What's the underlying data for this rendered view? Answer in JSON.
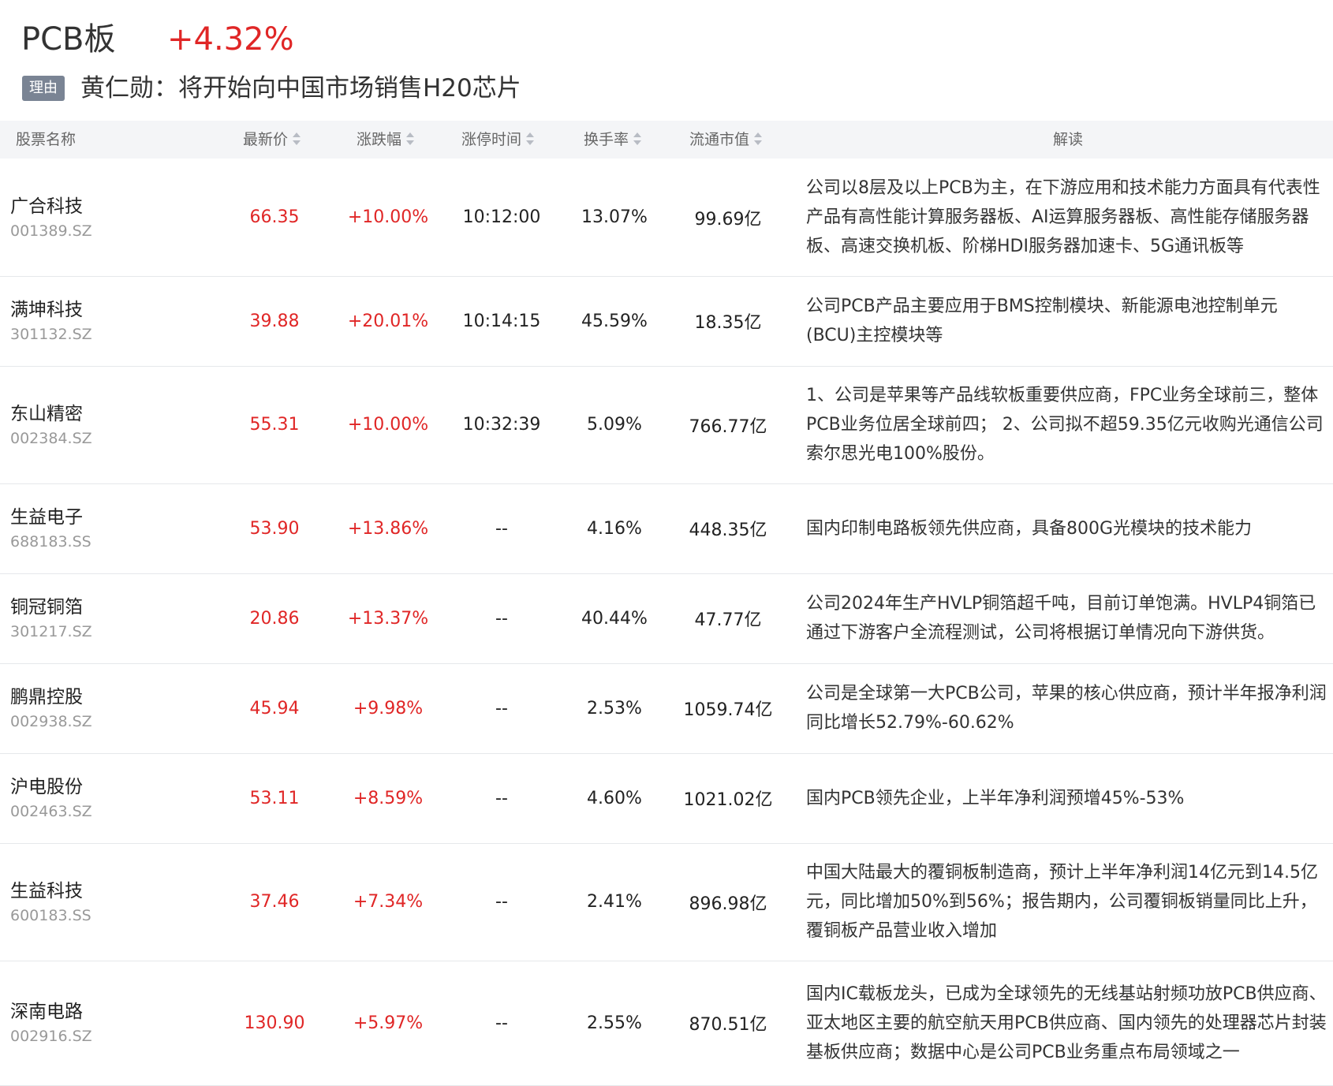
{
  "header": {
    "sector_name": "PCB板",
    "sector_change": "+4.32%",
    "reason_badge": "理由",
    "reason_text": "黄仁勋：将开始向中国市场销售H20芯片"
  },
  "table": {
    "columns": {
      "name": "股票名称",
      "price": "最新价",
      "change": "涨跌幅",
      "limit_time": "涨停时间",
      "turnover": "换手率",
      "market_cap": "流通市值",
      "desc": "解读"
    },
    "rows": [
      {
        "name": "广合科技",
        "code": "001389.SZ",
        "price": "66.35",
        "change": "+10.00%",
        "limit_time": "10:12:00",
        "turnover": "13.07%",
        "market_cap": "99.69亿",
        "desc": "公司以8层及以上PCB为主，在下游应用和技术能力方面具有代表性产品有高性能计算服务器板、AI运算服务器板、高性能存储服务器板、高速交换机板、阶梯HDI服务器加速卡、5G通讯板等"
      },
      {
        "name": "满坤科技",
        "code": "301132.SZ",
        "price": "39.88",
        "change": "+20.01%",
        "limit_time": "10:14:15",
        "turnover": "45.59%",
        "market_cap": "18.35亿",
        "desc": "公司PCB产品主要应用于BMS控制模块、新能源电池控制单元(BCU)主控模块等"
      },
      {
        "name": "东山精密",
        "code": "002384.SZ",
        "price": "55.31",
        "change": "+10.00%",
        "limit_time": "10:32:39",
        "turnover": "5.09%",
        "market_cap": "766.77亿",
        "desc": "1、公司是苹果等产品线软板重要供应商，FPC业务全球前三，整体PCB业务位居全球前四； 2、公司拟不超59.35亿元收购光通信公司索尔思光电100%股份。"
      },
      {
        "name": "生益电子",
        "code": "688183.SS",
        "price": "53.90",
        "change": "+13.86%",
        "limit_time": "--",
        "turnover": "4.16%",
        "market_cap": "448.35亿",
        "desc": "国内印制电路板领先供应商，具备800G光模块的技术能力"
      },
      {
        "name": "铜冠铜箔",
        "code": "301217.SZ",
        "price": "20.86",
        "change": "+13.37%",
        "limit_time": "--",
        "turnover": "40.44%",
        "market_cap": "47.77亿",
        "desc": "公司2024年生产HVLP铜箔超千吨，目前订单饱满。HVLP4铜箔已通过下游客户全流程测试，公司将根据订单情况向下游供货。"
      },
      {
        "name": "鹏鼎控股",
        "code": "002938.SZ",
        "price": "45.94",
        "change": "+9.98%",
        "limit_time": "--",
        "turnover": "2.53%",
        "market_cap": "1059.74亿",
        "desc": "公司是全球第一大PCB公司，苹果的核心供应商，预计半年报净利润同比增长52.79%-60.62%"
      },
      {
        "name": "沪电股份",
        "code": "002463.SZ",
        "price": "53.11",
        "change": "+8.59%",
        "limit_time": "--",
        "turnover": "4.60%",
        "market_cap": "1021.02亿",
        "desc": "国内PCB领先企业，上半年净利润预增45%-53%"
      },
      {
        "name": "生益科技",
        "code": "600183.SS",
        "price": "37.46",
        "change": "+7.34%",
        "limit_time": "--",
        "turnover": "2.41%",
        "market_cap": "896.98亿",
        "desc": "中国大陆最大的覆铜板制造商，预计上半年净利润14亿元到14.5亿元，同比增加50%到56%；报告期内，公司覆铜板销量同比上升，覆铜板产品营业收入增加"
      },
      {
        "name": "深南电路",
        "code": "002916.SZ",
        "price": "130.90",
        "change": "+5.97%",
        "limit_time": "--",
        "turnover": "2.55%",
        "market_cap": "870.51亿",
        "desc": "国内IC载板龙头，已成为全球领先的无线基站射频功放PCB供应商、亚太地区主要的航空航天用PCB供应商、国内领先的处理器芯片封装基板供应商；数据中心是公司PCB业务重点布局领域之一"
      }
    ]
  }
}
